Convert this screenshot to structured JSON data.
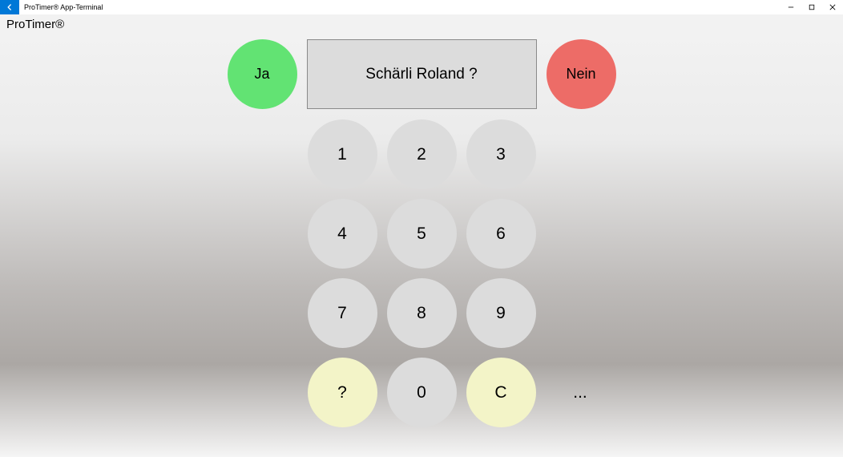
{
  "window": {
    "title": "ProTimer® App-Terminal"
  },
  "header": {
    "brand": "ProTimer®"
  },
  "confirm": {
    "yes_label": "Ja",
    "no_label": "Nein",
    "display_text": "Schärli Roland ?"
  },
  "keypad": {
    "k1": "1",
    "k2": "2",
    "k3": "3",
    "k4": "4",
    "k5": "5",
    "k6": "6",
    "k7": "7",
    "k8": "8",
    "k9": "9",
    "kquestion": "?",
    "k0": "0",
    "kclear": "C",
    "dots": "..."
  }
}
